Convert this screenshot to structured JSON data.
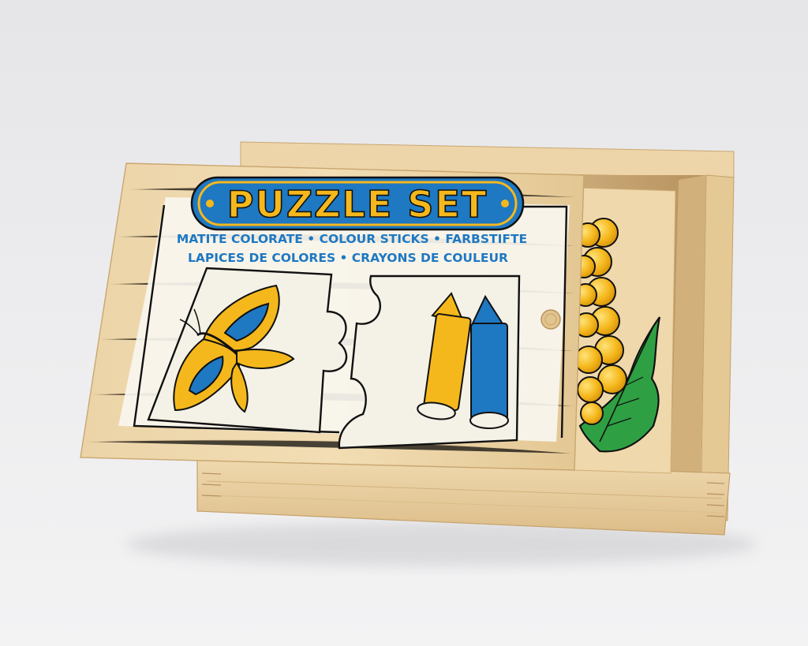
{
  "lid": {
    "title": "PUZZLE SET",
    "subtitle_line1": "MATITE COLORATE • COLOUR STICKS • FARBSTIFTE",
    "subtitle_line2": "LAPICES DE COLORES • CRAYONS DE COULEUR"
  },
  "colors": {
    "wood": "#e9d2a6",
    "wood_dark": "#d8b985",
    "label_yellow": "#f5b81c",
    "label_blue": "#1e78c2",
    "leaf_green": "#2ea043",
    "background": "#ececee"
  },
  "illustrations": [
    "butterfly-puzzle-piece",
    "crayons-puzzle-piece",
    "grapes-puzzle-piece"
  ]
}
